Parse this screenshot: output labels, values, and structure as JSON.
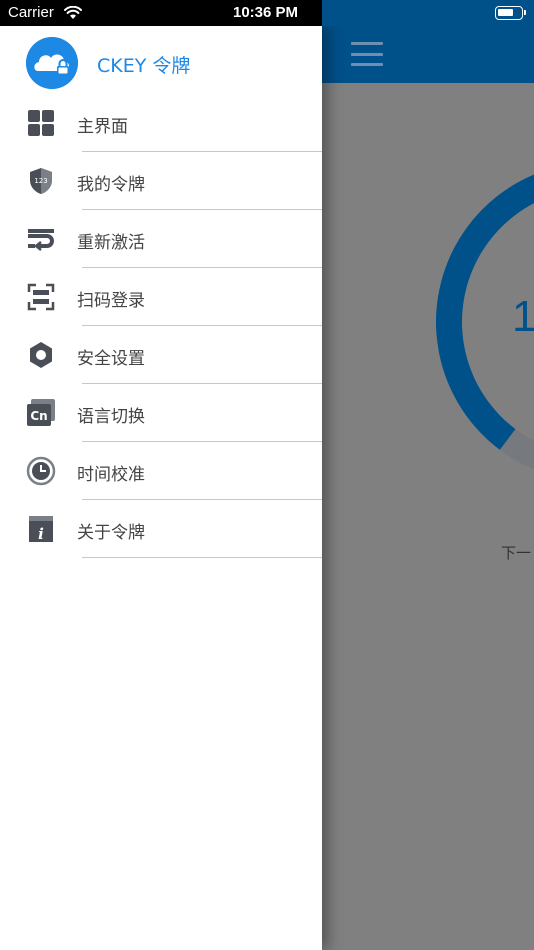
{
  "status_bar": {
    "carrier": "Carrier",
    "time": "10:36 PM",
    "battery_level": 0.7
  },
  "drawer": {
    "app_name": "CKEY 令牌",
    "items": [
      {
        "label": "主界面",
        "icon": "grid-icon"
      },
      {
        "label": "我的令牌",
        "icon": "shield-123-icon"
      },
      {
        "label": "重新激活",
        "icon": "reactivate-icon"
      },
      {
        "label": "扫码登录",
        "icon": "scan-icon"
      },
      {
        "label": "安全设置",
        "icon": "hexagon-settings-icon"
      },
      {
        "label": "语言切换",
        "icon": "language-cn-icon"
      },
      {
        "label": "时间校准",
        "icon": "clock-icon"
      },
      {
        "label": "关于令牌",
        "icon": "info-icon"
      }
    ]
  },
  "background": {
    "ring_number": "1",
    "next_label": "下一"
  },
  "colors": {
    "nav_blue": "#00508a",
    "accent_blue": "#1e88e5",
    "icon_gray": "#4a4f57",
    "overlay": "#808080"
  }
}
